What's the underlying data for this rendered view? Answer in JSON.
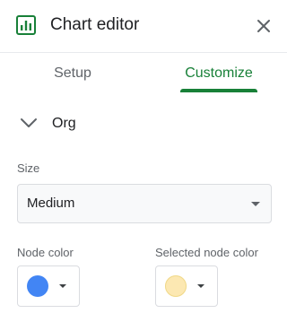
{
  "header": {
    "title": "Chart editor",
    "icon": "chart-icon",
    "close_icon": "close-icon"
  },
  "tabs": [
    {
      "label": "Setup",
      "active": false
    },
    {
      "label": "Customize",
      "active": true
    }
  ],
  "section": {
    "title": "Org",
    "expanded": true,
    "icon": "chevron-down-icon"
  },
  "size": {
    "label": "Size",
    "value": "Medium"
  },
  "node_color": {
    "label": "Node color",
    "color": "#4285f4"
  },
  "selected_node_color": {
    "label": "Selected node color",
    "color": "#fce8b2"
  },
  "colors": {
    "accent": "#188038",
    "text": "#202124",
    "secondary_text": "#5f6368"
  }
}
